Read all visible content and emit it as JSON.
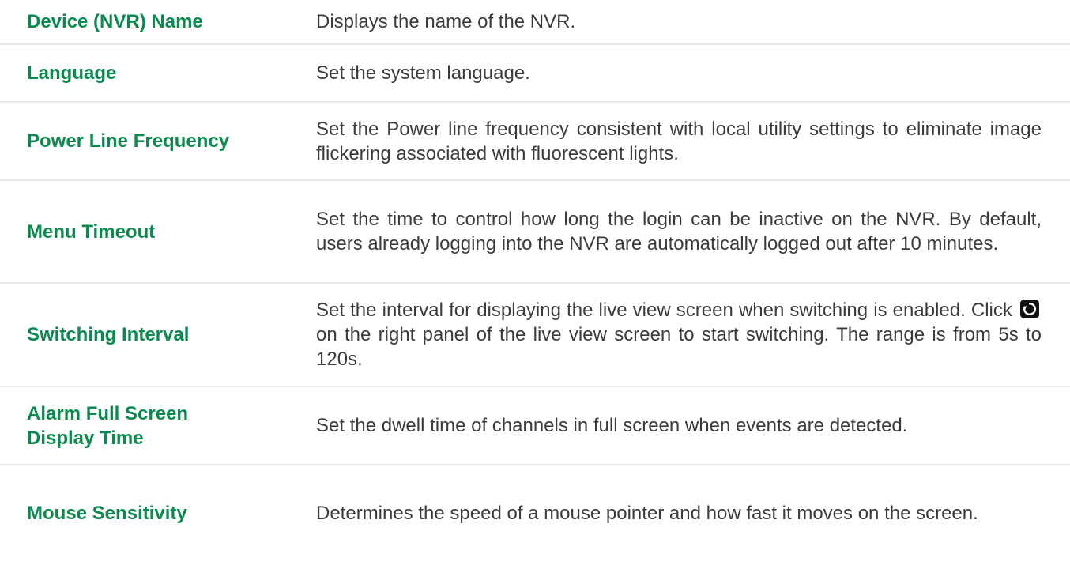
{
  "rows": [
    {
      "term": "Device (NVR) Name",
      "desc": "Displays the name of the NVR."
    },
    {
      "term": "Language",
      "desc": "Set the system language."
    },
    {
      "term": "Power Line Frequency",
      "desc": "Set the Power line frequency consistent with local utility settings to eliminate image flickering associated with fluorescent lights."
    },
    {
      "term": "Menu Timeout",
      "desc": "Set the time to control how long the login can be inactive on the NVR. By default, users already logging into the NVR are automatically logged out after 10 minutes."
    },
    {
      "term": "Switching Interval",
      "desc_before": "Set the interval for displaying the live view screen when switching is enabled. Click",
      "icon": "switching-refresh-icon",
      "desc_after": "on the right panel of the live view screen to start switching. The range is from 5s to 120s."
    },
    {
      "term_line1": "Alarm Full Screen",
      "term_line2": "Display Time",
      "desc": "Set the dwell time of channels in full screen when events are detected."
    },
    {
      "term": "Mouse Sensitivity",
      "desc": "Determines the speed of a mouse pointer and how fast it moves on the screen."
    }
  ],
  "colors": {
    "term": "#0a8a4e",
    "desc": "#3b3b3b",
    "divider": "#e3e9ef"
  }
}
